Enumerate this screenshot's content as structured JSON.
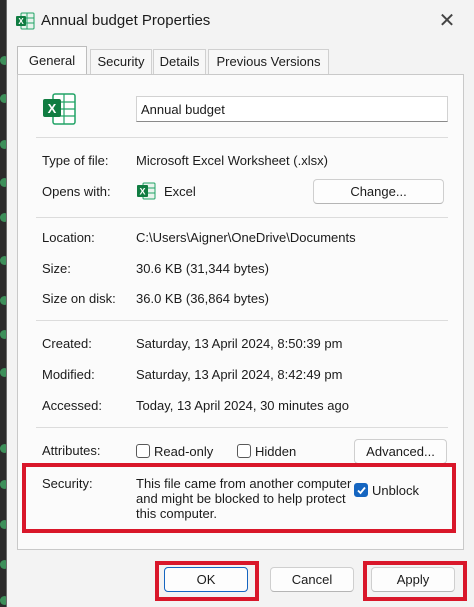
{
  "window": {
    "title": "Annual budget Properties"
  },
  "tabs": [
    {
      "label": "General",
      "active": true
    },
    {
      "label": "Security",
      "active": false
    },
    {
      "label": "Details",
      "active": false
    },
    {
      "label": "Previous Versions",
      "active": false
    }
  ],
  "file": {
    "name": "Annual budget"
  },
  "info": {
    "type_label": "Type of file:",
    "type_value": "Microsoft Excel Worksheet (.xlsx)",
    "opens_label": "Opens with:",
    "opens_value": "Excel",
    "change_label": "Change...",
    "location_label": "Location:",
    "location_value": "C:\\Users\\Aigner\\OneDrive\\Documents",
    "size_label": "Size:",
    "size_value": "30.6 KB (31,344 bytes)",
    "disk_label": "Size on disk:",
    "disk_value": "36.0 KB (36,864 bytes)",
    "created_label": "Created:",
    "created_value": "Saturday, 13 April 2024, 8:50:39 pm",
    "modified_label": "Modified:",
    "modified_value": "Saturday, 13 April 2024, 8:42:49 pm",
    "accessed_label": "Accessed:",
    "accessed_value": "Today, 13 April 2024, 30 minutes ago"
  },
  "attributes": {
    "label": "Attributes:",
    "readonly_label": "Read-only",
    "readonly_checked": false,
    "hidden_label": "Hidden",
    "hidden_checked": false,
    "advanced_label": "Advanced..."
  },
  "security": {
    "label": "Security:",
    "line1": "This file came from another computer",
    "line2": "and might be blocked to help protect",
    "line3": "this computer.",
    "unblock_label": "Unblock",
    "unblock_checked": true
  },
  "footer": {
    "ok_label": "OK",
    "cancel_label": "Cancel",
    "apply_label": "Apply"
  },
  "colors": {
    "highlight": "#d9172a",
    "checkbox_accent": "#1565c0",
    "excel_green": "#107c41"
  }
}
